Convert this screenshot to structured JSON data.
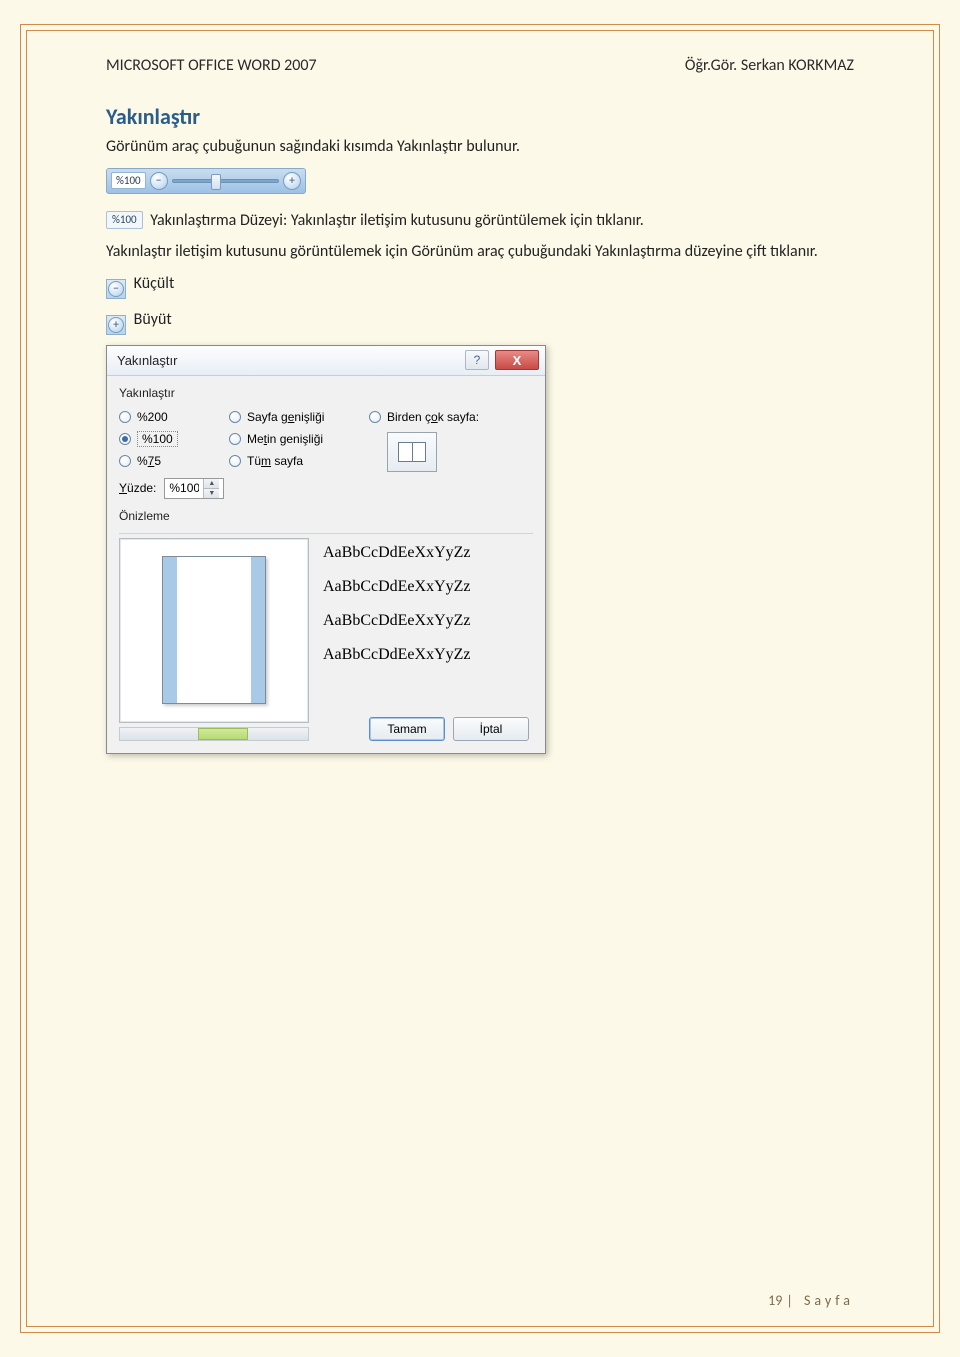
{
  "header": {
    "left": "MICROSOFT OFFICE WORD 2007",
    "right": "Öğr.Gör. Serkan KORKMAZ"
  },
  "section_title": "Yakınlaştır",
  "para1": "Görünüm araç çubuğunun sağındaki kısımda Yakınlaştır bulunur.",
  "zoom_slider": {
    "pct": "%100",
    "minus": "−",
    "plus": "+"
  },
  "inline_pct_icon": "%100",
  "para2": "Yakınlaştırma Düzeyi: Yakınlaştır iletişim kutusunu görüntülemek için tıklanır.",
  "para3": "Yakınlaştır iletişim kutusunu görüntülemek için Görünüm araç çubuğundaki Yakınlaştırma düzeyine çift tıklanır.",
  "icon_minus": "−",
  "label_kucult": "Küçült",
  "icon_plus": "+",
  "label_buyut": "Büyüt",
  "dialog": {
    "title": "Yakınlaştır",
    "help": "?",
    "close": "X",
    "group_label": "Yakınlaştır",
    "r200": "%200",
    "r100": "%100",
    "r75": "%75",
    "r_page_w_pre": "Sayfa g",
    "r_page_w_u": "e",
    "r_page_w_post": "nişliği",
    "r_text_w_pre": "Me",
    "r_text_w_u": "t",
    "r_text_w_post": "in genişliği",
    "r_whole_pre": "Tü",
    "r_whole_u": "m",
    "r_whole_post": " sayfa",
    "r_multi_pre": "Birden ç",
    "r_multi_u": "o",
    "r_multi_post": "k sayfa:",
    "percent_pre": "",
    "percent_u": "Y",
    "percent_post": "üzde:",
    "percent_val": "%100",
    "preview_label": "Önizleme",
    "sample": "AaBbCcDdEeXxYyZz",
    "ok": "Tamam",
    "cancel": "İptal"
  },
  "footer": {
    "num": "19",
    "sep": "|",
    "word": "Sayfa"
  }
}
